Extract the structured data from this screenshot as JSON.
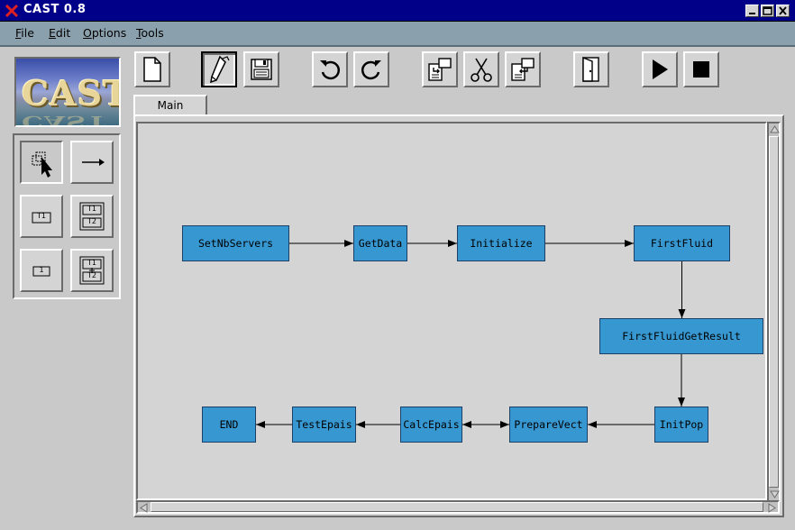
{
  "window": {
    "title": "CAST  0.8",
    "controls": [
      "minimize-icon",
      "maximize-icon",
      "close-icon"
    ]
  },
  "menu": {
    "items": [
      {
        "label_u": "F",
        "label_rest": "ile"
      },
      {
        "label_u": "E",
        "label_rest": "dit"
      },
      {
        "label_u": "O",
        "label_rest": "ptions"
      },
      {
        "label_u": "T",
        "label_rest": "ools"
      }
    ]
  },
  "logo": {
    "text": "CAST"
  },
  "toolbar": {
    "buttons": [
      "new-document-icon",
      "edit-pen-icon",
      "save-disk-icon",
      "undo-icon",
      "redo-icon",
      "copy-icon",
      "cut-scissors-icon",
      "paste-icon",
      "exit-door-icon",
      "play-icon",
      "stop-icon"
    ],
    "active": "edit-pen-icon"
  },
  "palette": {
    "buttons": [
      {
        "icon": "select-pointer-icon",
        "label": ""
      },
      {
        "icon": "connect-arrow-icon",
        "label": ""
      },
      {
        "icon": "task-box-icon",
        "label": "T1"
      },
      {
        "icon": "sequence-tasks-icon",
        "label": "T1",
        "label2": "T2"
      },
      {
        "icon": "single-box-icon",
        "label": "1"
      },
      {
        "icon": "parallel-tasks-icon",
        "label": "T1",
        "label2": "T2"
      }
    ]
  },
  "tabs": [
    {
      "label": "Main",
      "active": true
    }
  ],
  "diagram": {
    "colors": {
      "node_fill": "#3697d1",
      "node_border": "#1b3f66",
      "edge": "#000000",
      "canvas": "#d4d4d4"
    },
    "nodes": {
      "setnbservers": "SetNbServers",
      "getdata": "GetData",
      "initialize": "Initialize",
      "firstfluid": "FirstFluid",
      "firstfluidgetresult": "FirstFluidGetResult",
      "initpop": "InitPop",
      "preparevect": "PrepareVect",
      "calcepais": "CalcEpais",
      "testepais": "TestEpais",
      "end": "END"
    },
    "edges": [
      [
        "setnbservers",
        "getdata"
      ],
      [
        "getdata",
        "initialize"
      ],
      [
        "initialize",
        "firstfluid"
      ],
      [
        "firstfluid",
        "firstfluidgetresult"
      ],
      [
        "firstfluidgetresult",
        "initpop"
      ],
      [
        "initpop",
        "preparevect"
      ],
      [
        "preparevect",
        "calcepais"
      ],
      [
        "calcepais",
        "testepais"
      ],
      [
        "testepais",
        "end"
      ],
      [
        "testepais",
        "preparevect"
      ]
    ]
  }
}
